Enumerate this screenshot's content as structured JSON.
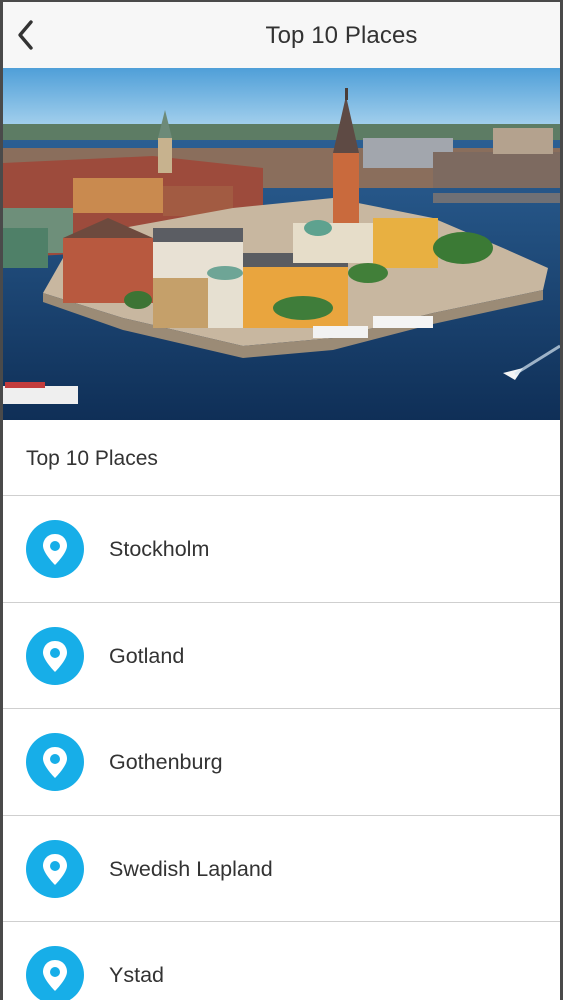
{
  "header": {
    "title": "Top 10 Places",
    "back_icon": "chevron-left-icon"
  },
  "hero": {
    "image": "aerial city island photo"
  },
  "section": {
    "title": "Top 10 Places"
  },
  "places": [
    {
      "label": "Stockholm",
      "icon": "map-pin-icon"
    },
    {
      "label": "Gotland",
      "icon": "map-pin-icon"
    },
    {
      "label": "Gothenburg",
      "icon": "map-pin-icon"
    },
    {
      "label": "Swedish Lapland",
      "icon": "map-pin-icon"
    },
    {
      "label": "Ystad",
      "icon": "map-pin-icon"
    }
  ],
  "colors": {
    "accent": "#17aee8",
    "navbar_bg": "#f7f7f7",
    "text": "#333333",
    "divider": "#cfcfcf"
  }
}
